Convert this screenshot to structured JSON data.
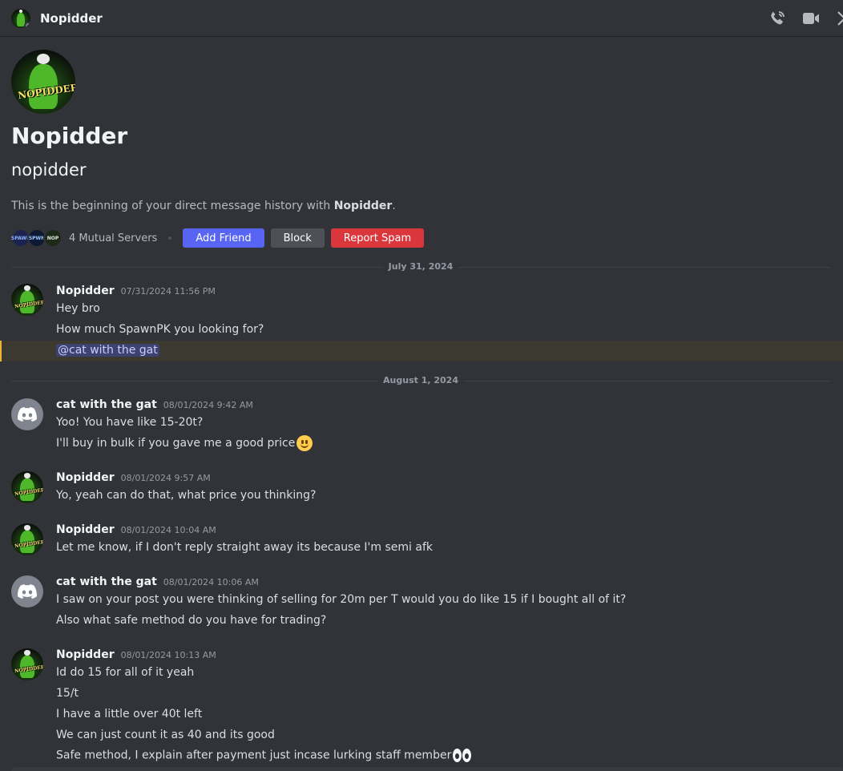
{
  "header": {
    "title": "Nopidder",
    "avatar_label": "NOPIDDER",
    "icons": [
      "phone-call-icon",
      "video-call-icon",
      "pinned-messages-icon"
    ]
  },
  "intro": {
    "display_name": "Nopidder",
    "username": "nopidder",
    "description_prefix": "This is the beginning of your direct message history with ",
    "description_name": "Nopidder",
    "description_suffix": ".",
    "mutual_servers": "4 Mutual Servers",
    "server_icon_labels": [
      "SPAWN",
      "SPWN",
      "NOP"
    ],
    "buttons": {
      "add_friend": "Add Friend",
      "block": "Block",
      "report_spam": "Report Spam"
    }
  },
  "dividers": [
    "July 31, 2024",
    "August 1, 2024"
  ],
  "messages": [
    {
      "author": "Nopidder",
      "time": "07/31/2024 11:56 PM",
      "lines": [
        "Hey bro",
        "How much SpawnPK you looking for?"
      ],
      "mention": "@cat with the gat"
    },
    {
      "author": "cat with the gat",
      "time": "08/01/2024 9:42 AM",
      "lines": [
        "Yoo! You have like 15-20t?",
        "I'll buy in bulk if you gave me a good price"
      ]
    },
    {
      "author": "Nopidder",
      "time": "08/01/2024 9:57 AM",
      "lines": [
        "Yo, yeah can do that, what price you thinking?"
      ]
    },
    {
      "author": "Nopidder",
      "time": "08/01/2024 10:04 AM",
      "lines": [
        "Let me know, if I don't reply straight away its because I'm semi afk"
      ]
    },
    {
      "author": "cat with the gat",
      "time": "08/01/2024 10:06 AM",
      "lines": [
        "I saw on your post you were thinking of selling for 20m per T would you do like 15 if I bought all of it?",
        "Also what safe method do you have for trading?"
      ]
    },
    {
      "author": "Nopidder",
      "time": "08/01/2024 10:13 AM",
      "lines": [
        "Id do 15 for all of it yeah",
        "15/t",
        "I have a little over 40t left",
        "We can just count it as 40 and its good",
        "Safe method, I explain after payment just incase lurking staff member"
      ]
    }
  ],
  "colors": {
    "background": "#313338",
    "brand_blue": "#5865f2",
    "danger_red": "#da373c",
    "mention_highlight": "#3c3930"
  }
}
